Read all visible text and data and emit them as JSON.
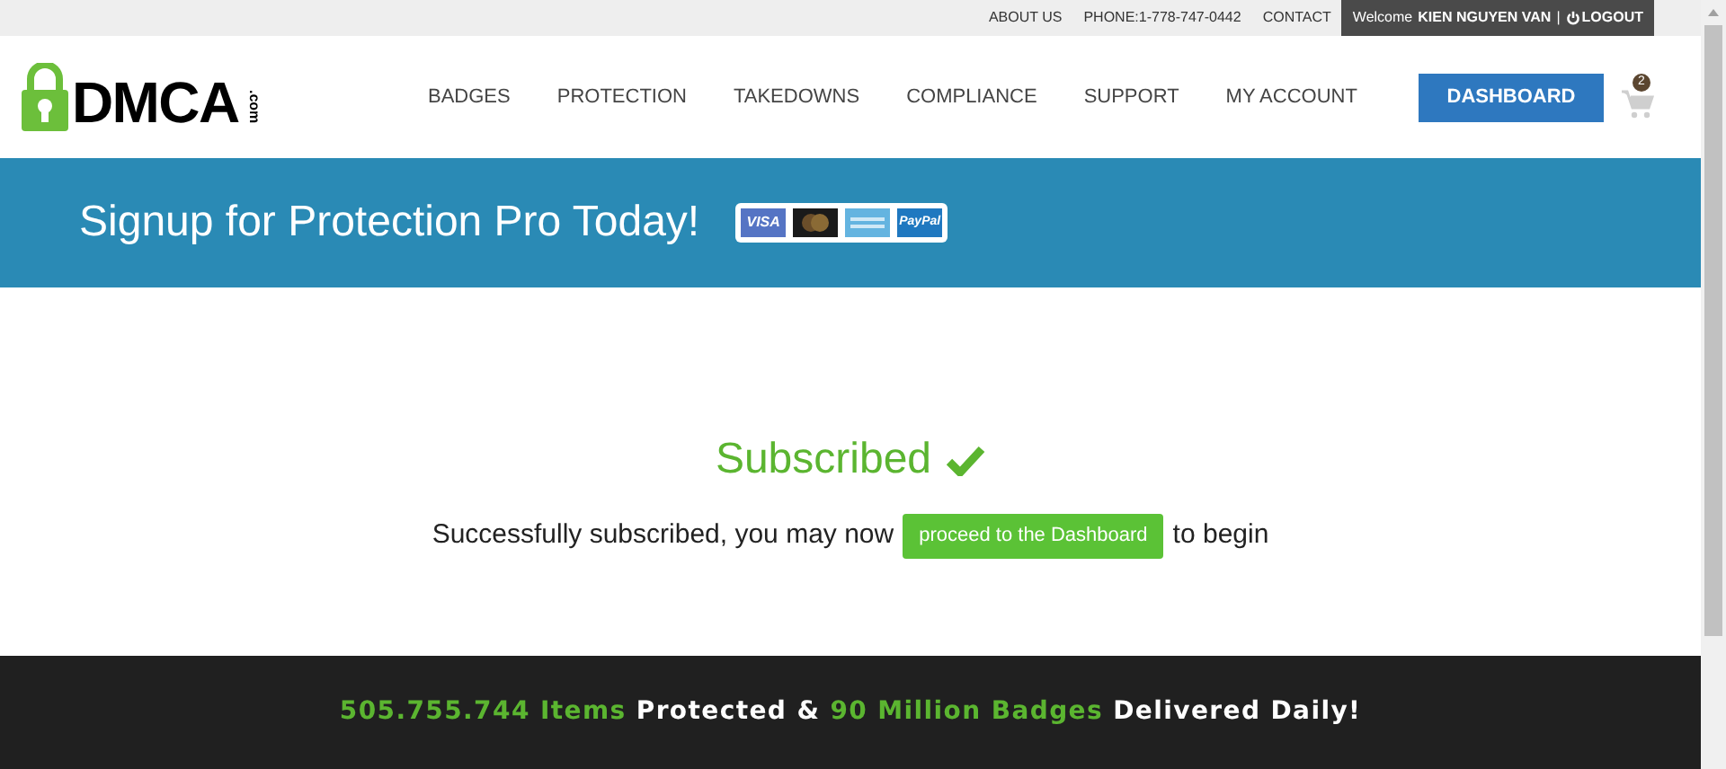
{
  "top_bar": {
    "links": [
      "ABOUT US",
      "PHONE:1-778-747-0442",
      "CONTACT"
    ],
    "welcome": "Welcome",
    "user": "KIEN NGUYEN VAN",
    "separator": "|",
    "logout": "LOGOUT"
  },
  "header": {
    "logo": {
      "text": "DMCA",
      "suffix": ".com"
    },
    "nav": [
      "BADGES",
      "PROTECTION",
      "TAKEDOWNS",
      "COMPLIANCE",
      "SUPPORT",
      "MY ACCOUNT"
    ],
    "dashboard_button": "DASHBOARD",
    "cart_count": "2"
  },
  "banner": {
    "title": "Signup for Protection Pro Today!",
    "cards": [
      {
        "kind": "visa",
        "label": "VISA"
      },
      {
        "kind": "mastercard"
      },
      {
        "kind": "amex"
      },
      {
        "kind": "paypal",
        "label": "PayPal"
      }
    ]
  },
  "status": {
    "title": "Subscribed",
    "message_before": "Successfully subscribed, you may now",
    "button": "proceed to the Dashboard",
    "message_after": "to begin"
  },
  "footer": {
    "segments": [
      {
        "text": "505.755.744 Items",
        "highlight": true
      },
      {
        "text": "Protected &",
        "highlight": false
      },
      {
        "text": "90 Million Badges",
        "highlight": true
      },
      {
        "text": "Delivered Daily!",
        "highlight": false
      }
    ]
  }
}
